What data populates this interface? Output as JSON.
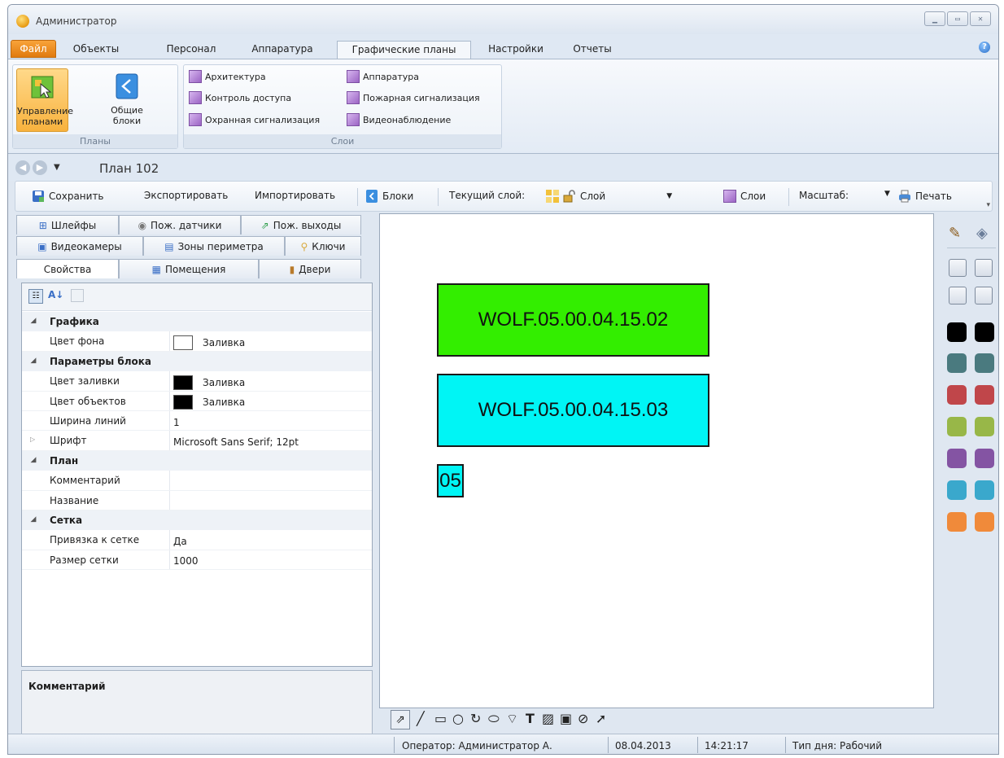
{
  "window": {
    "title": "Администратор"
  },
  "menu_tabs": [
    "Файл",
    "Объекты",
    "Персонал",
    "Аппаратура",
    "Графические планы",
    "Настройки",
    "Отчеты"
  ],
  "ribbon": {
    "plans_group": {
      "label": "Планы",
      "manage_line1": "Управление",
      "manage_line2": "планами",
      "blocks_line1": "Общие",
      "blocks_line2": "блоки"
    },
    "layers_group": {
      "label": "Слои",
      "items": [
        "Архитектура",
        "Аппаратура",
        "Контроль доступа",
        "Пожарная сигнализация",
        "Охранная сигнализация",
        "Видеонаблюдение"
      ]
    }
  },
  "nav": {
    "title": "План 102"
  },
  "toolbar": {
    "save": "Сохранить",
    "export": "Экспортировать",
    "import": "Импортировать",
    "blocks": "Блоки",
    "current_layer_label": "Текущий слой:",
    "layer_value": "Слой",
    "layers": "Слои",
    "scale_label": "Масштаб:",
    "print": "Печать"
  },
  "panel_tabs": {
    "row1": [
      "Шлейфы",
      "Пож. датчики",
      "Пож. выходы"
    ],
    "row2": [
      "Видеокамеры",
      "Зоны периметра",
      "Ключи"
    ],
    "row3": [
      "Свойства",
      "Помещения",
      "Двери"
    ]
  },
  "properties": {
    "cat_graphics": "Графика",
    "bg_color": "Цвет фона",
    "bg_color_value": "Заливка",
    "cat_block": "Параметры блока",
    "fill_color": "Цвет заливки",
    "fill_color_value": "Заливка",
    "obj_color": "Цвет объектов",
    "obj_color_value": "Заливка",
    "line_width": "Ширина линий",
    "line_width_value": "1",
    "font": "Шрифт",
    "font_value": "Microsoft Sans Serif; 12pt",
    "cat_plan": "План",
    "comment": "Комментарий",
    "name": "Название",
    "cat_grid": "Сетка",
    "snap": "Привязка к сетке",
    "snap_value": "Да",
    "grid_size": "Размер сетки",
    "grid_size_value": "1000"
  },
  "comment_panel": {
    "title": "Комментарий"
  },
  "canvas_blocks": [
    {
      "text": "WOLF.05.00.04.15.02",
      "color": "#33ee00"
    },
    {
      "text": "WOLF.05.00.04.15.03",
      "color": "#00f5f5"
    },
    {
      "text": "05",
      "color": "#00f5f5"
    }
  ],
  "palette": [
    "#000000",
    "#4a7a7f",
    "#c0464a",
    "#98b748",
    "#8454a3",
    "#3aa8cc",
    "#f08a3a"
  ],
  "status": {
    "operator": "Оператор:  Администратор А.",
    "date": "08.04.2013",
    "time": "14:21:17",
    "day_type": "Тип дня:  Рабочий"
  }
}
